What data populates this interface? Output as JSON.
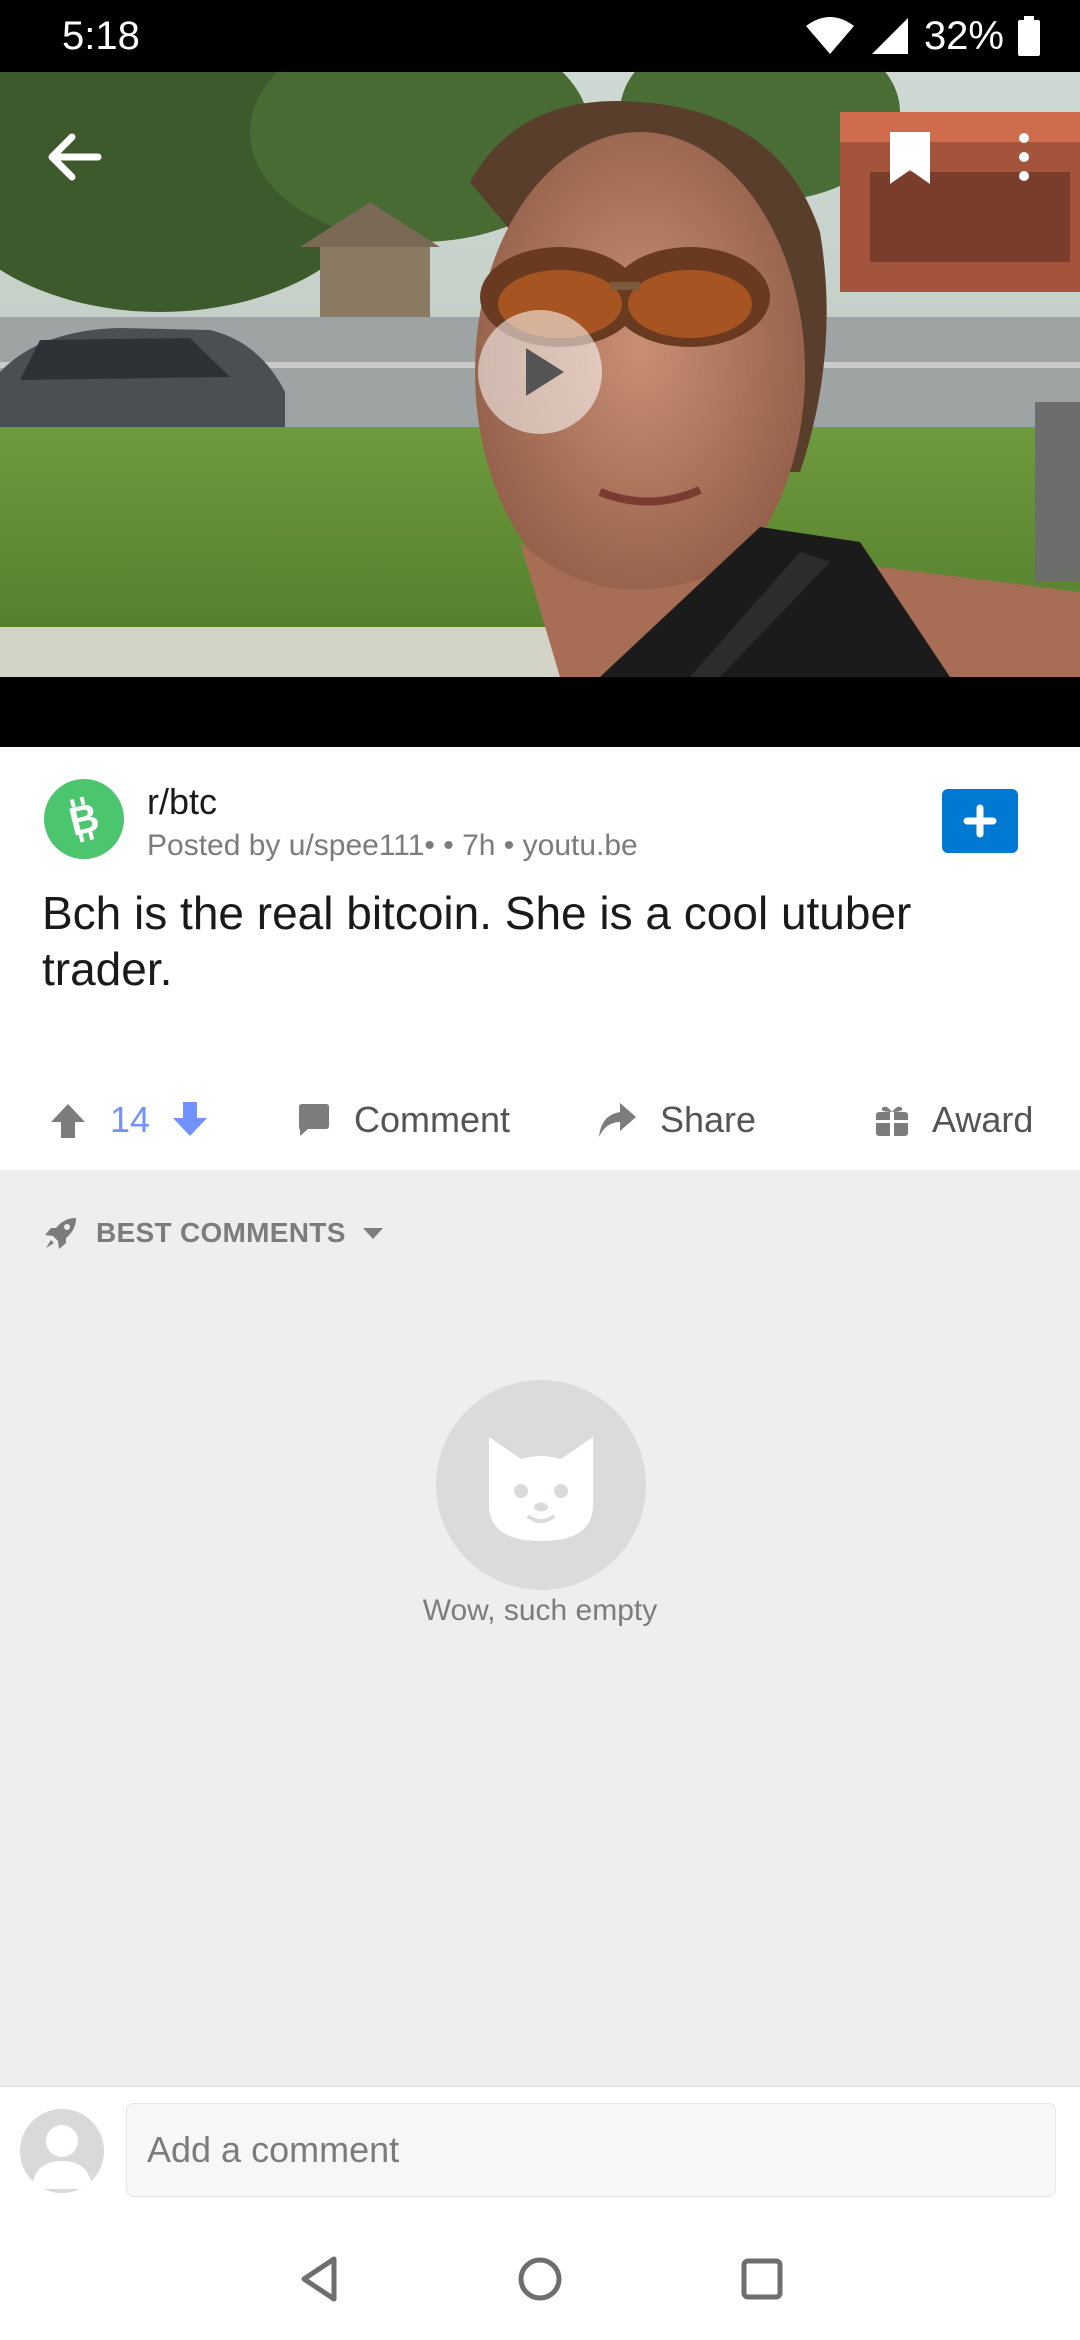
{
  "status_bar": {
    "time": "5:18",
    "battery": "32%"
  },
  "video": {
    "play_icon": "play-icon",
    "back_icon": "arrow-left-icon",
    "bookmark_icon": "bookmark-icon",
    "more_icon": "more-vertical-icon"
  },
  "post": {
    "subreddit": "r/btc",
    "meta": "Posted by u/spee111• • 7h • youtu.be",
    "title": "Bch is the real bitcoin. She is a cool utuber trader.",
    "join_icon": "plus-icon"
  },
  "actions": {
    "vote_count": "14",
    "comment_label": "Comment",
    "share_label": "Share",
    "award_label": "Award"
  },
  "comments": {
    "sort_label": "BEST COMMENTS",
    "empty_text": "Wow, such empty"
  },
  "comment_bar": {
    "placeholder": "Add a comment"
  },
  "colors": {
    "accent_blue": "#0079d3",
    "upvote_count": "#7193ff",
    "subreddit_green": "#4cc56f"
  }
}
